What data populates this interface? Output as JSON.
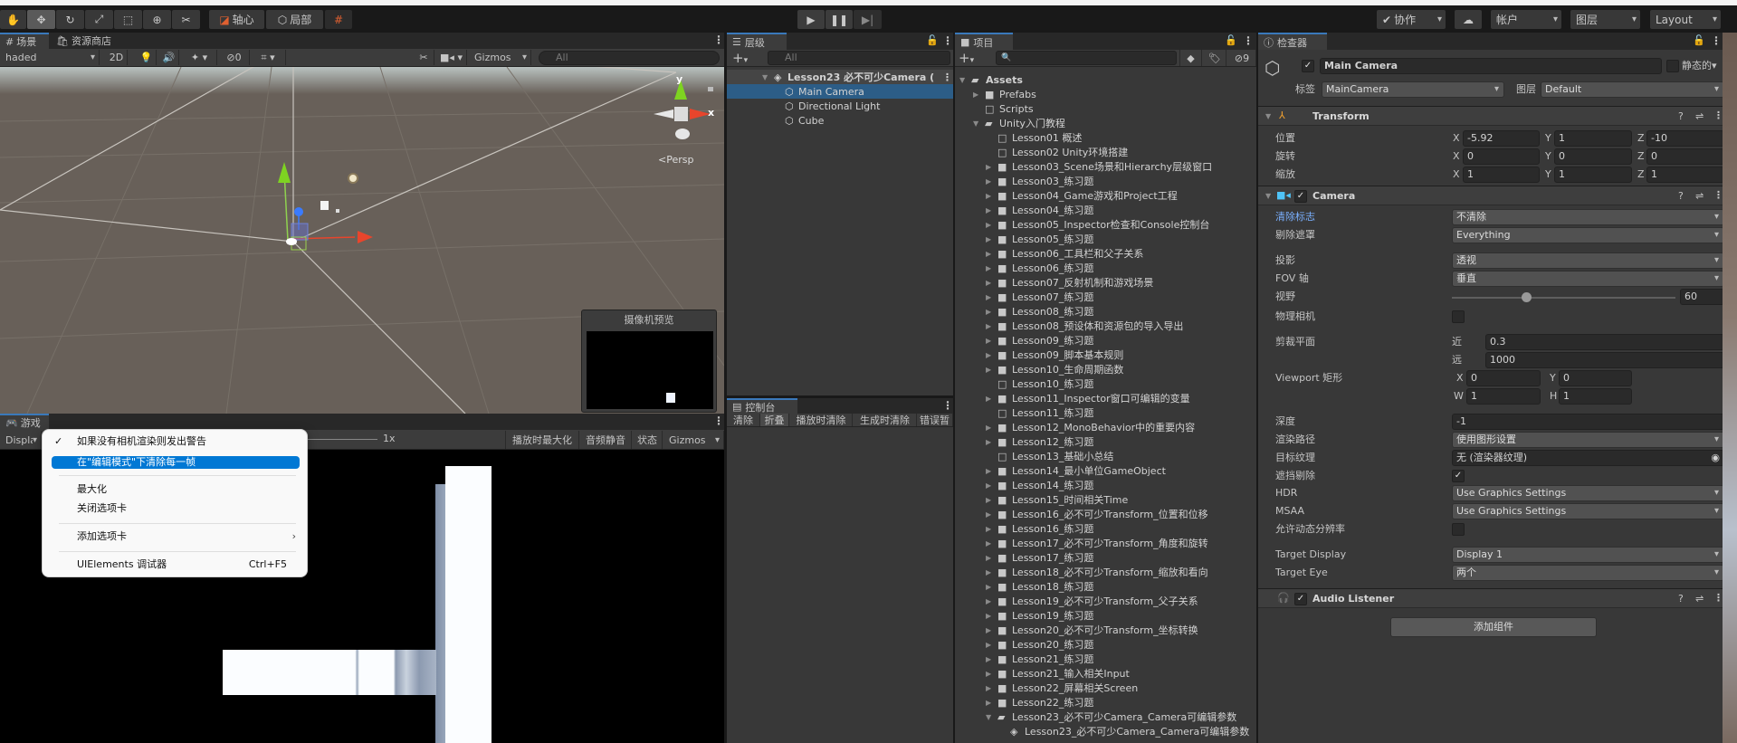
{
  "toolbar": {
    "tools": [
      "hand-tool",
      "move-tool",
      "rotate-tool",
      "scale-tool",
      "rect-tool",
      "transform-tool",
      "custom-tool"
    ],
    "pivot_label": "轴心",
    "local_label": "局部",
    "collab_label": "协作",
    "account_label": "帐户",
    "layers_label": "图层",
    "layout_label": "Layout"
  },
  "scene": {
    "tab_label": "场景",
    "asset_store_tab": "资源商店",
    "shading_mode": "haded",
    "mode_2d": "2D",
    "hidden_count": "0",
    "gizmos_label": "Gizmos",
    "search_placeholder": "All",
    "gizmo_y": "y",
    "gizmo_x": "x",
    "persp_label": "Persp",
    "camera_preview_title": "摄像机预览"
  },
  "game": {
    "tab_label": "游戏",
    "display_label": "Display 1",
    "scale_value": "1x",
    "maximize_on_play": "播放时最大化",
    "mute_audio": "音频静音",
    "stats": "状态",
    "gizmos_label": "Gizmos"
  },
  "context_menu": {
    "items": [
      {
        "label": "如果没有相机渲染则发出警告",
        "checked": true
      },
      {
        "label": "在\"编辑模式\"下清除每一帧",
        "highlighted": true
      },
      {
        "label": "最大化"
      },
      {
        "label": "关闭选项卡"
      },
      {
        "label": "添加选项卡",
        "submenu": true
      },
      {
        "label": "UIElements 调试器",
        "shortcut": "Ctrl+F5"
      }
    ]
  },
  "hierarchy": {
    "tab_label": "层级",
    "search_placeholder": "All",
    "scene_name": "Lesson23 必不可少Camera (",
    "items": [
      "Main Camera",
      "Directional Light",
      "Cube"
    ],
    "selected": "Main Camera"
  },
  "console": {
    "tab_label": "控制台",
    "buttons": [
      "清除",
      "折叠",
      "播放时清除",
      "生成时清除",
      "错误暂"
    ]
  },
  "project": {
    "tab_label": "项目",
    "hidden_count": "9",
    "items": [
      {
        "label": "Assets",
        "depth": 0,
        "arrow": "down",
        "icon": "folder-open",
        "bold": true
      },
      {
        "label": "Prefabs",
        "depth": 1,
        "arrow": "right",
        "icon": "folder"
      },
      {
        "label": "Scripts",
        "depth": 1,
        "arrow": "none",
        "icon": "folder-empty"
      },
      {
        "label": "Unity入门教程",
        "depth": 1,
        "arrow": "down",
        "icon": "folder-open"
      },
      {
        "label": "Lesson01 概述",
        "depth": 2,
        "arrow": "none",
        "icon": "folder-empty"
      },
      {
        "label": "Lesson02 Unity环境搭建",
        "depth": 2,
        "arrow": "none",
        "icon": "folder-empty"
      },
      {
        "label": "Lesson03_Scene场景和Hierarchy层级窗口",
        "depth": 2,
        "arrow": "right",
        "icon": "folder"
      },
      {
        "label": "Lesson03_练习题",
        "depth": 2,
        "arrow": "right",
        "icon": "folder"
      },
      {
        "label": "Lesson04_Game游戏和Project工程",
        "depth": 2,
        "arrow": "right",
        "icon": "folder"
      },
      {
        "label": "Lesson04_练习题",
        "depth": 2,
        "arrow": "right",
        "icon": "folder"
      },
      {
        "label": "Lesson05_Inspector检查和Console控制台",
        "depth": 2,
        "arrow": "right",
        "icon": "folder"
      },
      {
        "label": "Lesson05_练习题",
        "depth": 2,
        "arrow": "right",
        "icon": "folder"
      },
      {
        "label": "Lesson06_工具栏和父子关系",
        "depth": 2,
        "arrow": "right",
        "icon": "folder"
      },
      {
        "label": "Lesson06_练习题",
        "depth": 2,
        "arrow": "right",
        "icon": "folder"
      },
      {
        "label": "Lesson07_反射机制和游戏场景",
        "depth": 2,
        "arrow": "right",
        "icon": "folder"
      },
      {
        "label": "Lesson07_练习题",
        "depth": 2,
        "arrow": "right",
        "icon": "folder"
      },
      {
        "label": "Lesson08_练习题",
        "depth": 2,
        "arrow": "right",
        "icon": "folder"
      },
      {
        "label": "Lesson08_预设体和资源包的导入导出",
        "depth": 2,
        "arrow": "right",
        "icon": "folder"
      },
      {
        "label": "Lesson09_练习题",
        "depth": 2,
        "arrow": "right",
        "icon": "folder"
      },
      {
        "label": "Lesson09_脚本基本规则",
        "depth": 2,
        "arrow": "right",
        "icon": "folder"
      },
      {
        "label": "Lesson10_生命周期函数",
        "depth": 2,
        "arrow": "right",
        "icon": "folder"
      },
      {
        "label": "Lesson10_练习题",
        "depth": 2,
        "arrow": "none",
        "icon": "folder-empty"
      },
      {
        "label": "Lesson11_Inspector窗口可编辑的变量",
        "depth": 2,
        "arrow": "right",
        "icon": "folder"
      },
      {
        "label": "Lesson11_练习题",
        "depth": 2,
        "arrow": "none",
        "icon": "folder-empty"
      },
      {
        "label": "Lesson12_MonoBehavior中的重要内容",
        "depth": 2,
        "arrow": "right",
        "icon": "folder"
      },
      {
        "label": "Lesson12_练习题",
        "depth": 2,
        "arrow": "right",
        "icon": "folder"
      },
      {
        "label": "Lesson13_基础小总结",
        "depth": 2,
        "arrow": "none",
        "icon": "folder-empty"
      },
      {
        "label": "Lesson14_最小单位GameObject",
        "depth": 2,
        "arrow": "right",
        "icon": "folder"
      },
      {
        "label": "Lesson14_练习题",
        "depth": 2,
        "arrow": "right",
        "icon": "folder"
      },
      {
        "label": "Lesson15_时间相关Time",
        "depth": 2,
        "arrow": "right",
        "icon": "folder"
      },
      {
        "label": "Lesson16_必不可少Transform_位置和位移",
        "depth": 2,
        "arrow": "right",
        "icon": "folder"
      },
      {
        "label": "Lesson16_练习题",
        "depth": 2,
        "arrow": "right",
        "icon": "folder"
      },
      {
        "label": "Lesson17_必不可少Transform_角度和旋转",
        "depth": 2,
        "arrow": "right",
        "icon": "folder"
      },
      {
        "label": "Lesson17_练习题",
        "depth": 2,
        "arrow": "right",
        "icon": "folder"
      },
      {
        "label": "Lesson18_必不可少Transform_缩放和看向",
        "depth": 2,
        "arrow": "right",
        "icon": "folder"
      },
      {
        "label": "Lesson18_练习题",
        "depth": 2,
        "arrow": "right",
        "icon": "folder"
      },
      {
        "label": "Lesson19_必不可少Transform_父子关系",
        "depth": 2,
        "arrow": "right",
        "icon": "folder"
      },
      {
        "label": "Lesson19_练习题",
        "depth": 2,
        "arrow": "right",
        "icon": "folder"
      },
      {
        "label": "Lesson20_必不可少Transform_坐标转换",
        "depth": 2,
        "arrow": "right",
        "icon": "folder"
      },
      {
        "label": "Lesson20_练习题",
        "depth": 2,
        "arrow": "right",
        "icon": "folder"
      },
      {
        "label": "Lesson21_练习题",
        "depth": 2,
        "arrow": "right",
        "icon": "folder"
      },
      {
        "label": "Lesson21_输入相关Input",
        "depth": 2,
        "arrow": "right",
        "icon": "folder"
      },
      {
        "label": "Lesson22_屏幕相关Screen",
        "depth": 2,
        "arrow": "right",
        "icon": "folder"
      },
      {
        "label": "Lesson22_练习题",
        "depth": 2,
        "arrow": "right",
        "icon": "folder"
      },
      {
        "label": "Lesson23_必不可少Camera_Camera可编辑参数",
        "depth": 2,
        "arrow": "down",
        "icon": "folder-open"
      },
      {
        "label": "Lesson23_必不可少Camera_Camera可编辑参数",
        "depth": 3,
        "arrow": "none",
        "icon": "script"
      }
    ]
  },
  "inspector": {
    "tab_label": "检查器",
    "object_name": "Main Camera",
    "active": true,
    "static_label": "静态的",
    "static": false,
    "tag_label": "标签",
    "tag_value": "MainCamera",
    "layer_label": "图层",
    "layer_value": "Default",
    "transform": {
      "title": "Transform",
      "rows": [
        {
          "label": "位置",
          "x": "-5.92",
          "y": "1",
          "z": "-10"
        },
        {
          "label": "旋转",
          "x": "0",
          "y": "0",
          "z": "0"
        },
        {
          "label": "缩放",
          "x": "1",
          "y": "1",
          "z": "1"
        }
      ]
    },
    "camera": {
      "title": "Camera",
      "enabled": true,
      "clear_flags_label": "清除标志",
      "clear_flags": "不清除",
      "culling_mask_label": "剔除遮罩",
      "culling_mask": "Everything",
      "projection_label": "投影",
      "projection": "透视",
      "fov_axis_label": "FOV 轴",
      "fov_axis": "垂直",
      "fov_label": "视野",
      "fov": "60",
      "fov_min": 1,
      "fov_max": 179,
      "physical_label": "物理相机",
      "physical": false,
      "clipping_label": "剪裁平面",
      "near_label": "近",
      "near": "0.3",
      "far_label": "远",
      "far": "1000",
      "viewport_label": "Viewport 矩形",
      "vx": "0",
      "vy": "0",
      "vw": "1",
      "vh": "1",
      "depth_label": "深度",
      "depth": "-1",
      "render_path_label": "渲染路径",
      "render_path": "使用图形设置",
      "target_texture_label": "目标纹理",
      "target_texture": "无 (渲染器纹理)",
      "occlusion_label": "遮挡剔除",
      "occlusion": true,
      "hdr_label": "HDR",
      "hdr": "Use Graphics Settings",
      "msaa_label": "MSAA",
      "msaa": "Use Graphics Settings",
      "dynamic_res_label": "允许动态分辨率",
      "dynamic_res": false,
      "target_display_label": "Target Display",
      "target_display": "Display 1",
      "target_eye_label": "Target Eye",
      "target_eye": "两个"
    },
    "audio_listener": {
      "title": "Audio Listener",
      "enabled": true
    },
    "add_component": "添加组件"
  },
  "colors": {
    "accent": "#3a79bb",
    "selection": "#2c5d87",
    "menu_highlight": "#0078d4",
    "x_axis": "#e8452c",
    "y_axis": "#7ed321",
    "z_axis": "#3a7bff",
    "audio_icon": "#f4b400",
    "camera_icon": "#4fc3f7"
  }
}
